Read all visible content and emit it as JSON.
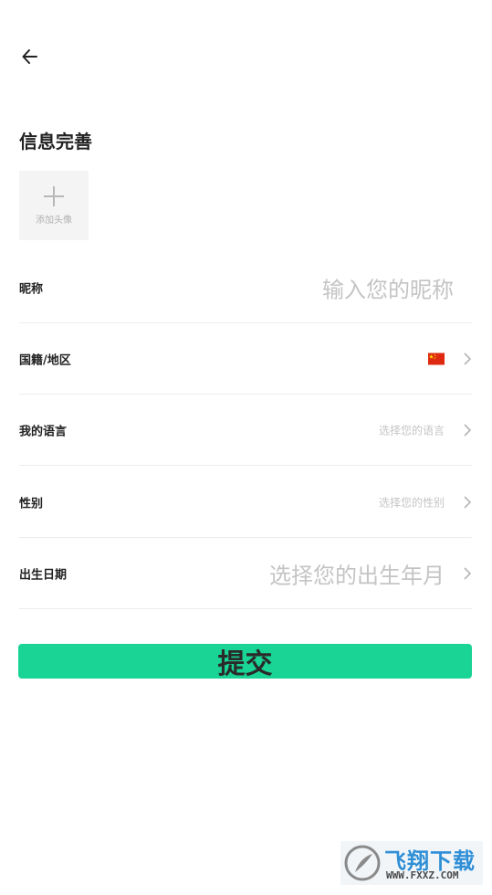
{
  "page": {
    "title": "信息完善"
  },
  "avatar": {
    "add_label": "添加头像"
  },
  "form": {
    "nickname": {
      "label": "昵称",
      "placeholder": "输入您的昵称"
    },
    "nationality": {
      "label": "国籍/地区",
      "flag": "china-flag"
    },
    "language": {
      "label": "我的语言",
      "placeholder": "选择您的语言"
    },
    "gender": {
      "label": "性别",
      "placeholder": "选择您的性别"
    },
    "birthdate": {
      "label": "出生日期",
      "placeholder": "选择您的出生年月"
    }
  },
  "submit_label": "提交",
  "watermark": {
    "brand": "飞翔下载",
    "url": "WWW.FXXZ.COM"
  },
  "colors": {
    "accent": "#19d494",
    "placeholder": "#c4c4c4",
    "divider": "#ececec"
  }
}
